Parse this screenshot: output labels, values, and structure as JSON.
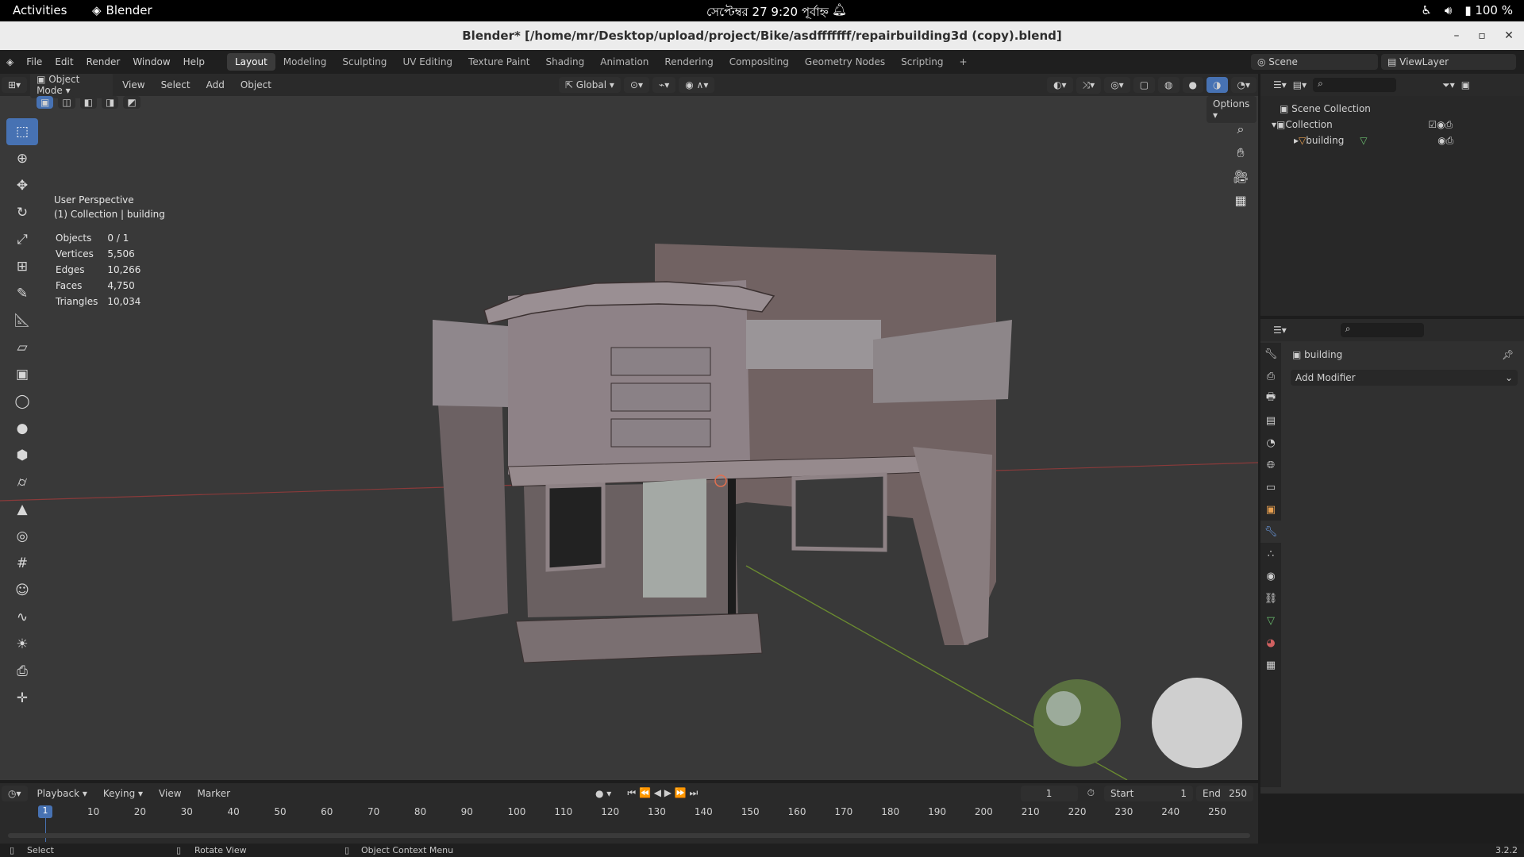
{
  "gnome": {
    "activities": "Activities",
    "app_name": "Blender",
    "clock": "সেপ্টেম্বর 27  9:20 পূর্বাহ্ন",
    "battery": "100 %"
  },
  "window": {
    "title": "Blender* [/home/mr/Desktop/upload/project/Bike/asdfffffff/repairbuilding3d (copy).blend]"
  },
  "menu": {
    "items": [
      "File",
      "Edit",
      "Render",
      "Window",
      "Help"
    ],
    "workspaces": [
      "Layout",
      "Modeling",
      "Sculpting",
      "UV Editing",
      "Texture Paint",
      "Shading",
      "Animation",
      "Rendering",
      "Compositing",
      "Geometry Nodes",
      "Scripting"
    ],
    "active_workspace": "Layout",
    "scene": "Scene",
    "view_layer": "ViewLayer"
  },
  "viewport_header": {
    "mode": "Object Mode",
    "menus": [
      "View",
      "Select",
      "Add",
      "Object"
    ],
    "orientation": "Global",
    "options": "Options"
  },
  "viewport": {
    "perspective": "User Perspective",
    "context": "(1) Collection | building",
    "stats": [
      {
        "label": "Objects",
        "value": "0 / 1"
      },
      {
        "label": "Vertices",
        "value": "5,506"
      },
      {
        "label": "Edges",
        "value": "10,266"
      },
      {
        "label": "Faces",
        "value": "4,750"
      },
      {
        "label": "Triangles",
        "value": "10,034"
      }
    ]
  },
  "outliner": {
    "scene_collection": "Scene Collection",
    "collection": "Collection",
    "object": "building"
  },
  "properties": {
    "object_name": "building",
    "add_modifier": "Add Modifier"
  },
  "timeline": {
    "menus": [
      "Playback",
      "Keying",
      "View",
      "Marker"
    ],
    "current_frame": "1",
    "start_label": "Start",
    "start": "1",
    "end_label": "End",
    "end": "250",
    "ticks": [
      "1",
      "10",
      "20",
      "30",
      "40",
      "50",
      "60",
      "70",
      "80",
      "90",
      "100",
      "110",
      "120",
      "130",
      "140",
      "150",
      "160",
      "170",
      "180",
      "190",
      "200",
      "210",
      "220",
      "230",
      "240",
      "250"
    ]
  },
  "status": {
    "select": "Select",
    "rotate": "Rotate View",
    "context_menu": "Object Context Menu",
    "version": "3.2.2"
  }
}
